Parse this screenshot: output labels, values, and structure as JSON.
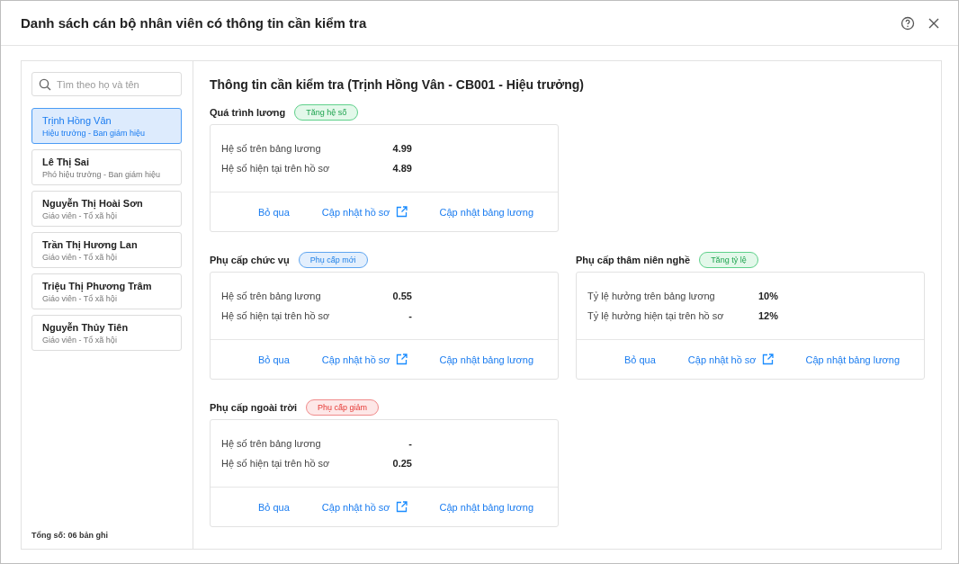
{
  "dialog": {
    "title": "Danh sách cán bộ nhân viên có thông tin cần kiểm tra"
  },
  "sidebar": {
    "search": {
      "placeholder": "Tìm theo họ và tên"
    },
    "employees": [
      {
        "name": "Trịnh Hồng Vân",
        "role": "Hiệu trưởng - Ban giám hiệu",
        "selected": true
      },
      {
        "name": "Lê Thị Sai",
        "role": "Phó hiệu trưởng - Ban giám hiệu",
        "selected": false
      },
      {
        "name": "Nguyễn Thị Hoài Sơn",
        "role": "Giáo viên - Tổ xã hội",
        "selected": false
      },
      {
        "name": "Trần Thị Hương Lan",
        "role": "Giáo viên - Tổ xã hội",
        "selected": false
      },
      {
        "name": "Triệu Thị Phương Trâm",
        "role": "Giáo viên - Tổ xã hội",
        "selected": false
      },
      {
        "name": "Nguyễn Thủy Tiên",
        "role": "Giáo viên - Tổ xã hội",
        "selected": false
      }
    ],
    "total": "Tổng số: 06 bản ghi"
  },
  "main": {
    "heading": "Thông tin cần kiểm tra (Trịnh Hồng Vân - CB001 - Hiệu trưởng)",
    "sections": [
      {
        "title": "Quá trình lương",
        "badge": {
          "label": "Tăng hệ số",
          "kind": "increase"
        },
        "rows": [
          {
            "label": "Hệ số trên bảng lương",
            "value": "4.99"
          },
          {
            "label": "Hệ số hiện tại trên hồ sơ",
            "value": "4.89"
          }
        ],
        "actions": [
          {
            "label": "Bỏ qua",
            "kind": "plain"
          },
          {
            "label": "Cập nhật hồ sơ",
            "kind": "external"
          },
          {
            "label": "Cập nhật bảng lương",
            "kind": "plain"
          }
        ]
      },
      {
        "title": "Phụ cấp chức vụ",
        "badge": {
          "label": "Phụ cấp mới",
          "kind": "new"
        },
        "rows": [
          {
            "label": "Hệ số trên bảng lương",
            "value": "0.55"
          },
          {
            "label": "Hệ số hiện tại trên hồ sơ",
            "value": "-"
          }
        ],
        "actions": [
          {
            "label": "Bỏ qua",
            "kind": "plain"
          },
          {
            "label": "Cập nhật hồ sơ",
            "kind": "external"
          },
          {
            "label": "Cập nhật bảng lương",
            "kind": "plain"
          }
        ]
      },
      {
        "title": "Phụ cấp thâm niên nghề",
        "badge": {
          "label": "Tăng tỷ lệ",
          "kind": "increase"
        },
        "rows": [
          {
            "label": "Tỷ lệ hưởng trên bảng lương",
            "value": "10%"
          },
          {
            "label": "Tỷ lệ hưởng hiện tại trên hồ sơ",
            "value": "12%"
          }
        ],
        "actions": [
          {
            "label": "Bỏ qua",
            "kind": "plain"
          },
          {
            "label": "Cập nhật hồ sơ",
            "kind": "external"
          },
          {
            "label": "Cập nhật bảng lương",
            "kind": "plain"
          }
        ]
      },
      {
        "title": "Phụ cấp ngoài trời",
        "badge": {
          "label": "Phụ cấp giảm",
          "kind": "decrease"
        },
        "rows": [
          {
            "label": "Hệ số trên bảng lương",
            "value": "-"
          },
          {
            "label": "Hệ số hiện tại trên hồ sơ",
            "value": "0.25"
          }
        ],
        "actions": [
          {
            "label": "Bỏ qua",
            "kind": "plain"
          },
          {
            "label": "Cập nhật hồ sơ",
            "kind": "external"
          },
          {
            "label": "Cập nhật bảng lương",
            "kind": "plain"
          }
        ]
      }
    ]
  }
}
